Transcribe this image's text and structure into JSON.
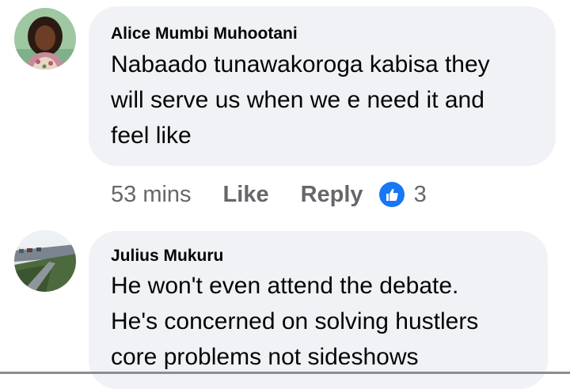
{
  "comments": [
    {
      "author": "Alice Mumbi Muhootani",
      "lines": [
        "Nabaado tunawakoroga kabisa they",
        "will serve us when we e need it and",
        "feel like"
      ],
      "time": "53 mins",
      "like_label": "Like",
      "reply_label": "Reply",
      "reaction_icon": "thumbs-up-icon",
      "reaction_count": "3",
      "colors": {
        "reaction": "#1877f2",
        "bubble": "#f0f2f5",
        "meta": "#65676b"
      }
    },
    {
      "author": "Julius Mukuru",
      "lines": [
        "He won't even attend the debate.",
        "He's concerned on solving hustlers",
        "core problems not sideshows"
      ]
    }
  ]
}
